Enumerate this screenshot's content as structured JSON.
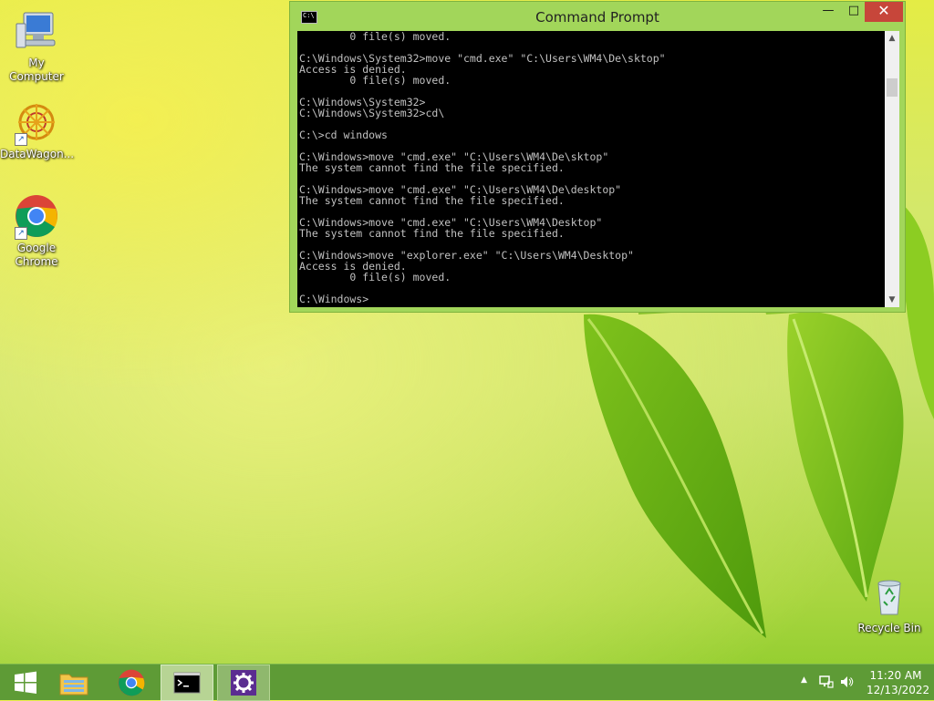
{
  "desktop": {
    "icons": [
      {
        "label": "My Computer"
      },
      {
        "label": "DataWagon..."
      },
      {
        "label": "Google Chrome"
      },
      {
        "label": "Recycle Bin"
      }
    ]
  },
  "cmd": {
    "title": "Command Prompt",
    "controls": {
      "minimize": "—",
      "maximize": "□",
      "close": "✕"
    },
    "lines": [
      "        0 file(s) moved.",
      "",
      "C:\\Windows\\System32>move \"cmd.exe\" \"C:\\Users\\WM4\\De\\sktop\"",
      "Access is denied.",
      "        0 file(s) moved.",
      "",
      "C:\\Windows\\System32>",
      "C:\\Windows\\System32>cd\\",
      "",
      "C:\\>cd windows",
      "",
      "C:\\Windows>move \"cmd.exe\" \"C:\\Users\\WM4\\De\\sktop\"",
      "The system cannot find the file specified.",
      "",
      "C:\\Windows>move \"cmd.exe\" \"C:\\Users\\WM4\\De\\desktop\"",
      "The system cannot find the file specified.",
      "",
      "C:\\Windows>move \"cmd.exe\" \"C:\\Users\\WM4\\Desktop\"",
      "The system cannot find the file specified.",
      "",
      "C:\\Windows>move \"explorer.exe\" \"C:\\Users\\WM4\\Desktop\"",
      "Access is denied.",
      "        0 file(s) moved.",
      "",
      "C:\\Windows>"
    ]
  },
  "taskbar": {
    "items": [
      "start-button",
      "file-explorer",
      "google-chrome",
      "command-prompt",
      "settings"
    ],
    "time": "11:20 AM",
    "date": "12/13/2022"
  },
  "colors": {
    "taskbar": "#5e9b36",
    "window_frame": "#a2d65a",
    "close_button": "#c7463a",
    "console_bg": "#000000",
    "console_text": "#c0c0c0"
  }
}
